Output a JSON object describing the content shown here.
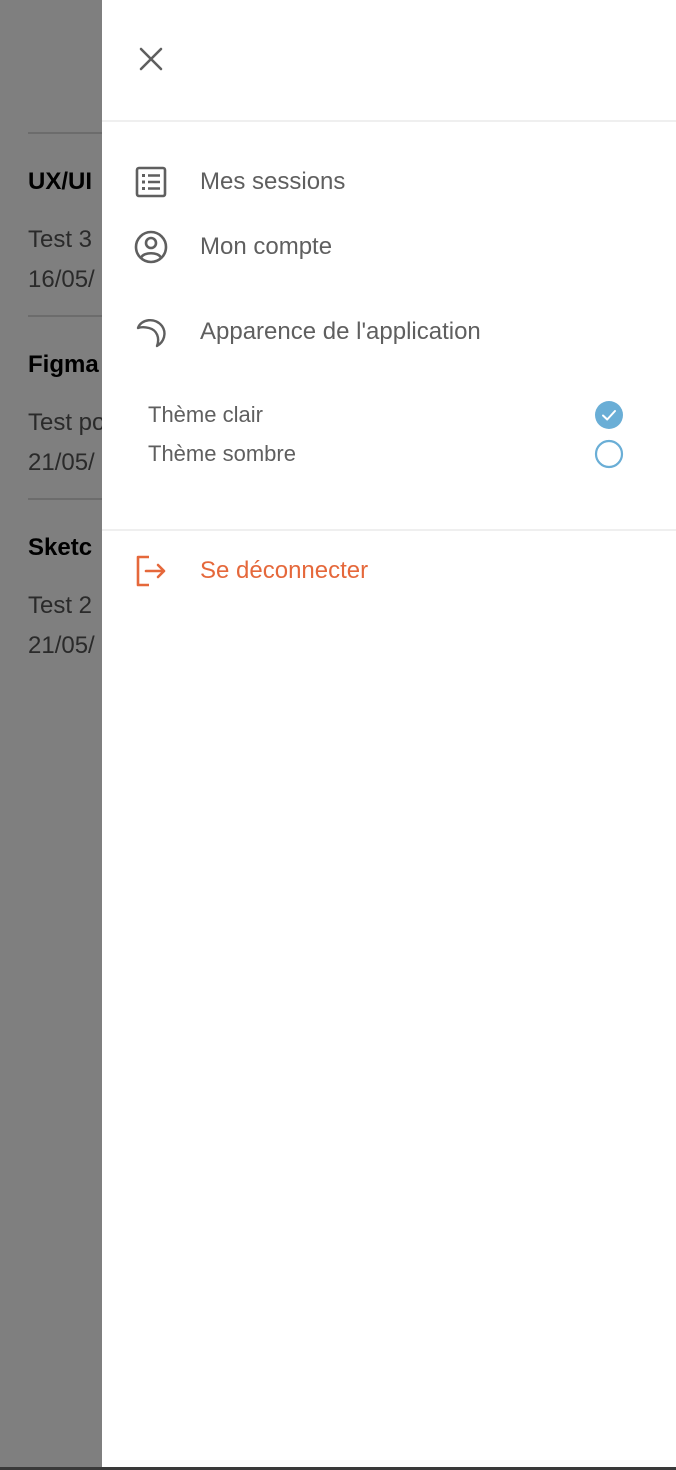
{
  "background": {
    "cards": [
      {
        "title": "UX/UI",
        "desc": "Test 3",
        "date": "16/05/"
      },
      {
        "title": "Figma",
        "desc": "Test po",
        "date": "21/05/"
      },
      {
        "title": "Sketc",
        "desc": "Test 2",
        "date": "21/05/"
      }
    ]
  },
  "drawer": {
    "menu": {
      "sessions_label": "Mes sessions",
      "account_label": "Mon compte",
      "appearance_label": "Apparence de l'application"
    },
    "themes": {
      "light_label": "Thème clair",
      "light_selected": true,
      "dark_label": "Thème sombre",
      "dark_selected": false
    },
    "logout_label": "Se déconnecter"
  },
  "colors": {
    "accent": "#6aaed6",
    "logout": "#e5683b",
    "text": "#5f5f5f",
    "overlay": "rgba(0,0,0,0.5)"
  },
  "icons": {
    "close": "close-icon",
    "sessions": "list-icon",
    "account": "user-circle-icon",
    "appearance": "moon-icon",
    "logout": "logout-icon"
  }
}
